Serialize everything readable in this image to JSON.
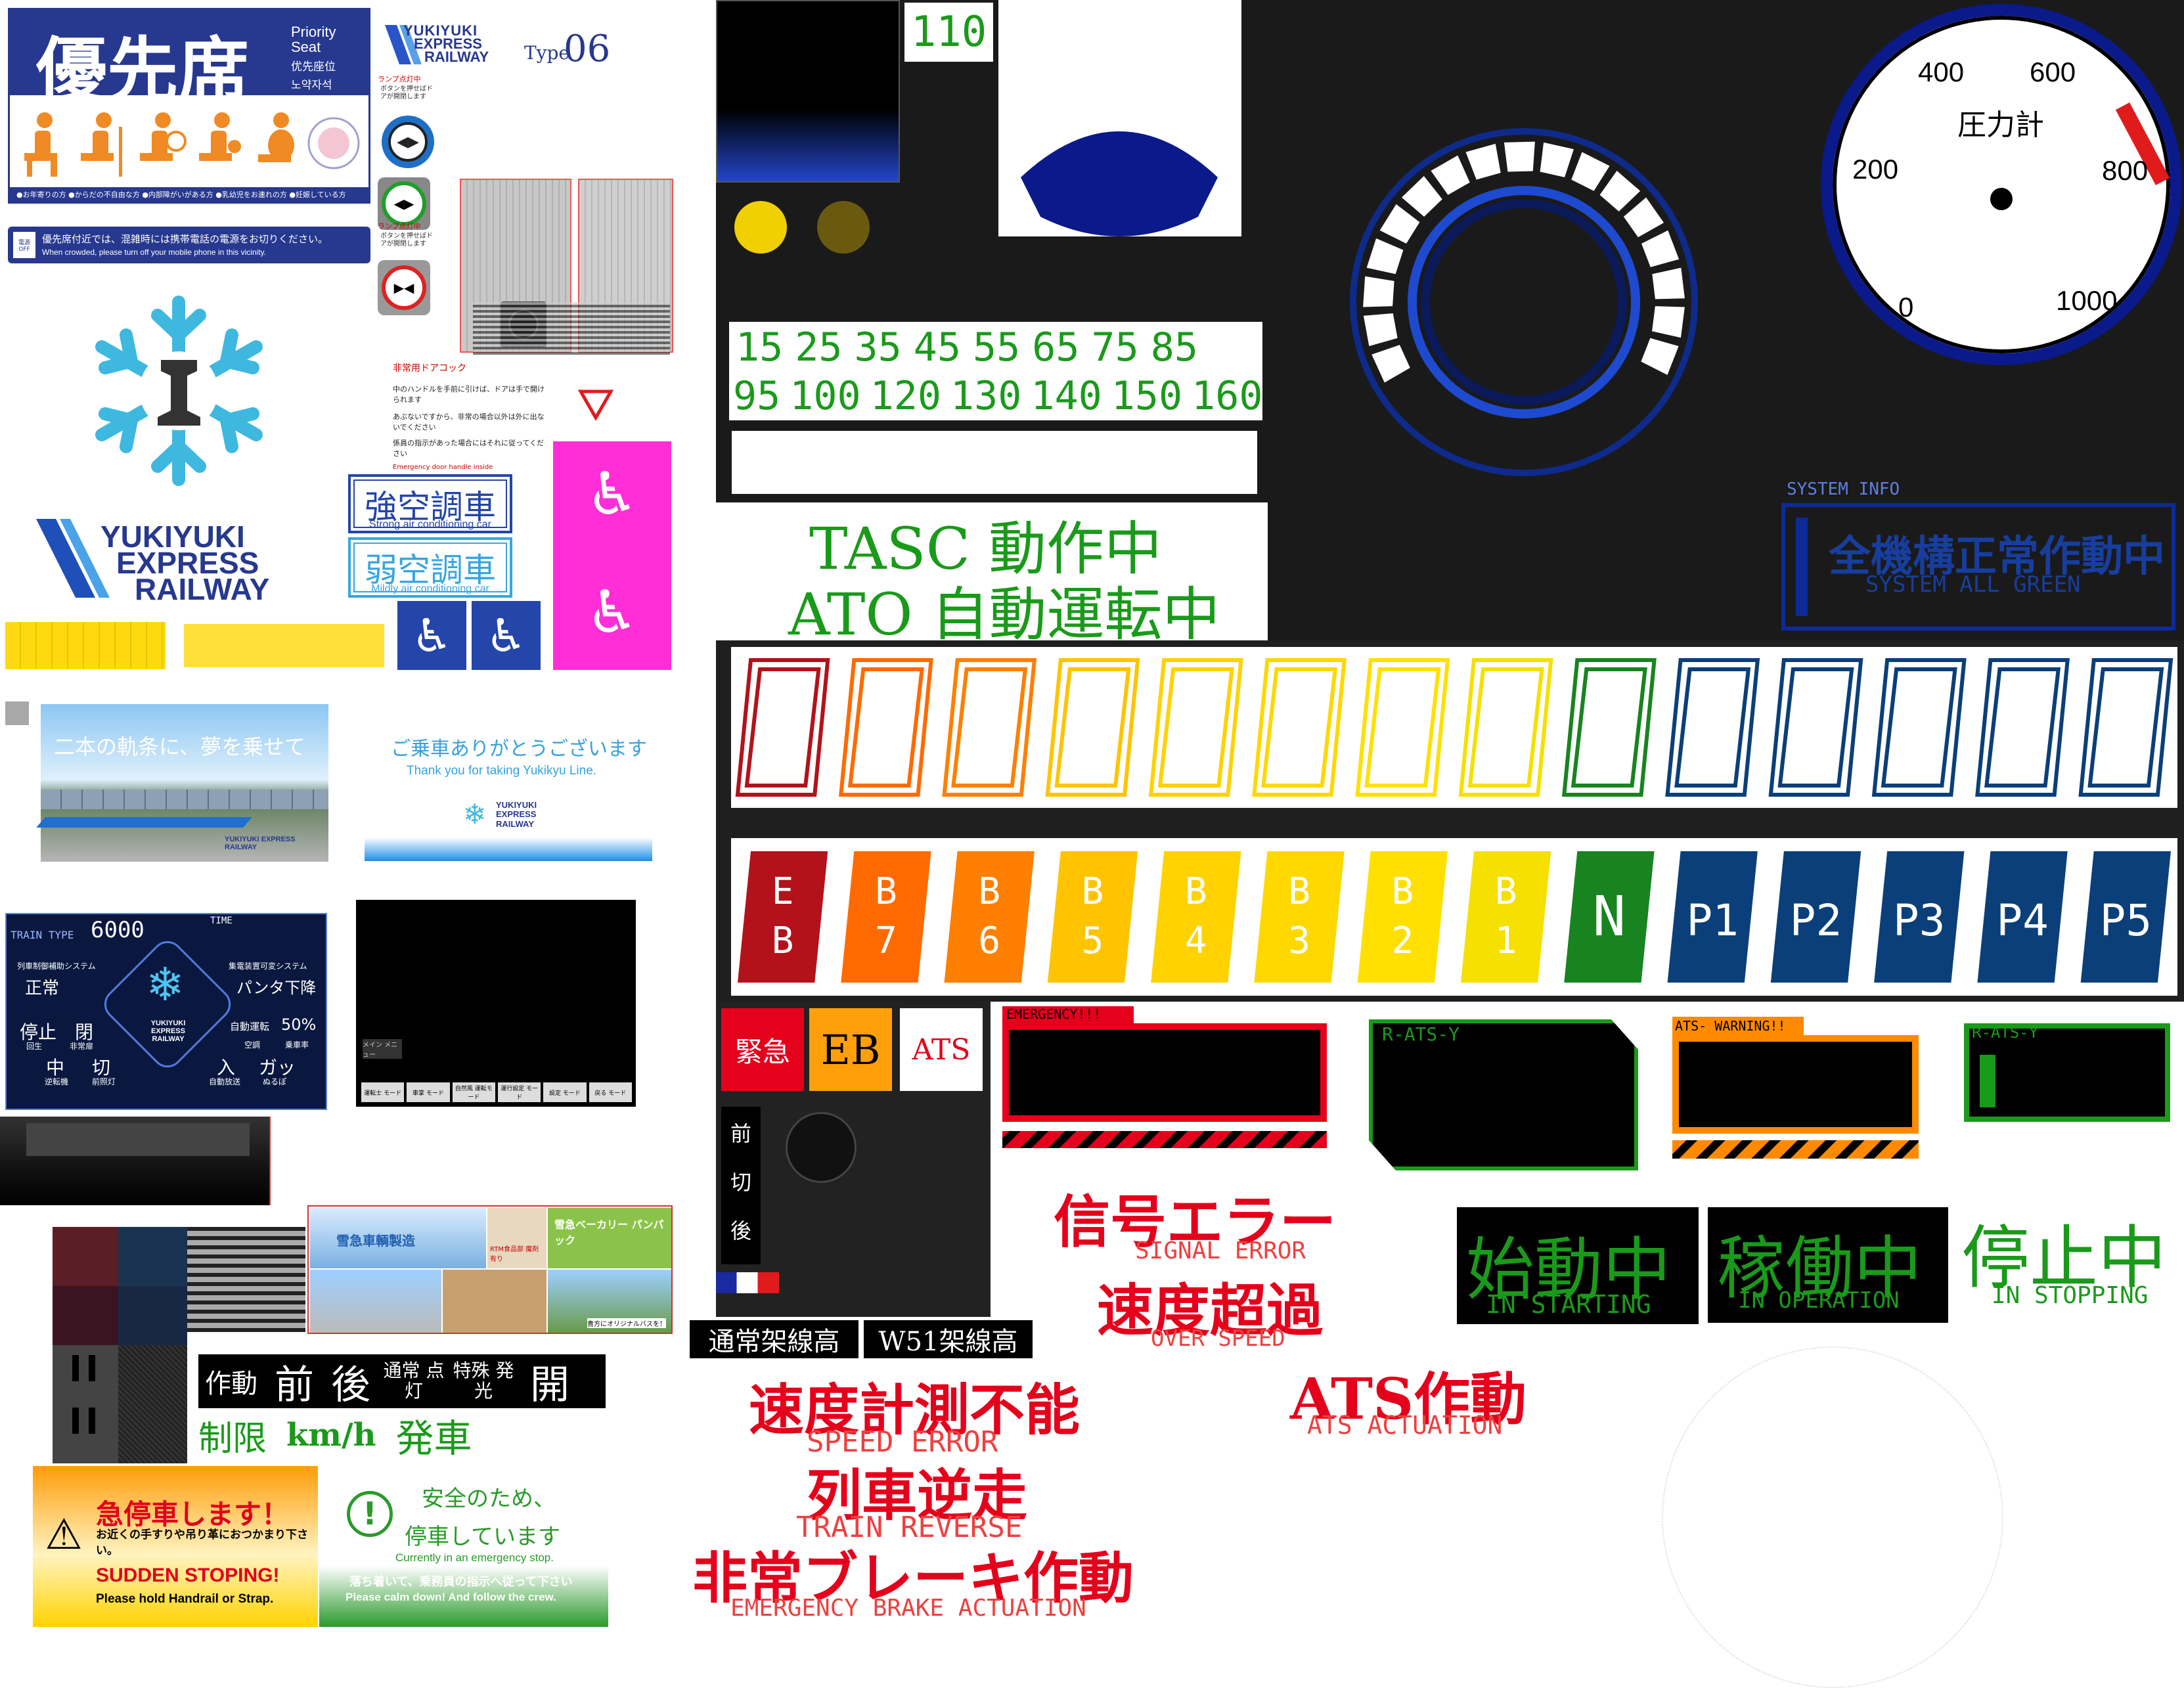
{
  "left": {
    "priority_seat": {
      "title": "優先席",
      "en": "Priority Seat",
      "zh": "优先座位",
      "ko": "노약자석",
      "notes": "●お年寄りの方 ●からだの不自由な方 ●内部障がいがある方 ●乳幼児をお連れの方 ●妊娠している方"
    },
    "phone_notice": {
      "jp": "優先席付近では、混雑時には携帯電話の電源をお切りください。",
      "en": "When crowded, please turn off your mobile phone in this vicinity.",
      "badge": "電源 OFF"
    },
    "type_logo": {
      "line1": "YUKIYUKI",
      "line2": "EXPRESS",
      "line3": "RAILWAY",
      "type": "Type",
      "num": "06"
    },
    "door_buttons": {
      "lamp_on": "ランプ点灯中",
      "push": "ボタンを押せばドアが開閉します"
    },
    "big_logo": {
      "line1": "YUKIYUKI",
      "line2": "EXPRESS",
      "line3": "RAILWAY"
    },
    "door_cock": {
      "title": "非常用ドアコック",
      "body1": "中のハンドルを手前に引けば、ドアは手で開けられます",
      "body2": "あぶないですから、非常の場合以外は外に出ないでください",
      "body3": "係員の指示があった場合にはそれに従ってください",
      "en": "Emergency door handle inside"
    },
    "ac_strong": {
      "jp": "強空調車",
      "en": "Strong air conditioning car"
    },
    "ac_weak": {
      "jp": "弱空調車",
      "en": "Mildly air conditioning car"
    },
    "banner": {
      "text": "二本の軌条に、夢を乗せて",
      "logo": "YUKIYUKI EXPRESS RAILWAY"
    },
    "thanks": {
      "jp": "ご乗車ありがとうございます",
      "en": "Thank you for taking Yukikyu Line.",
      "logo": "YUKIYUKI EXPRESS RAILWAY"
    },
    "train_panel": {
      "type_label": "TRAIN TYPE",
      "type_num": "6000",
      "time_label": "TIME",
      "sys1": "列車制御補助システム",
      "sys1_val": "正常",
      "sys2": "集電装置可変システム",
      "sys2_val": "パンタ下降",
      "stop": "停止",
      "stop_sub": "回生",
      "close": "閉",
      "close_sub": "非常扉",
      "auto": "自動運転",
      "auto_sub": "空調",
      "pct": "50%",
      "pct_sub": "乗車率",
      "mid": "中",
      "mid_sub": "逆転機",
      "cut": "切",
      "cut_sub": "前照灯",
      "in": "入",
      "in_sub": "自動放送",
      "gatsu": "ガッ",
      "gatsu_sub": "ぬるぽ",
      "logo": "YUKIYUKI EXPRESS RAILWAY"
    },
    "menu_panel": {
      "menu": "メイン メニュー",
      "buttons": [
        "運転士 モード",
        "車掌 モード",
        "自然風 運転モード",
        "運行設定 モード",
        "設定 モード",
        "戻る モード"
      ]
    },
    "ads": {
      "maker": "雪急車輌製造",
      "food": "RTM食品部 魔剤有り",
      "bread": "雪急ベーカリー パンパック",
      "bus": "貴方にオリジナルバスを！"
    },
    "mode_row1": [
      "作動",
      "前",
      "後",
      "通常 点灯",
      "特殊 発光",
      "開"
    ],
    "mode_row2": [
      "制限",
      "km/h",
      "発車"
    ],
    "emg_stop": {
      "jp": "急停車します！",
      "sub": "お近くの手すりや吊り革におつかまり下さい。",
      "en": "SUDDEN STOPING!",
      "en_sub": "Please hold Handrail or Strap."
    },
    "safety": {
      "jp1": "安全のため、",
      "jp2": "停車しています",
      "en": "Currently in an emergency stop.",
      "jp3": "落ち着いて、乗務員の指示へ従って下さい",
      "en2": "Please calm down! And follow the crew."
    }
  },
  "mid": {
    "speed_limit": "110",
    "speed_row1": [
      "15",
      "25",
      "35",
      "45",
      "55",
      "65",
      "75",
      "85"
    ],
    "speed_row2": [
      "95",
      "100",
      "120",
      "130",
      "140",
      "150",
      "160"
    ],
    "tasc": "TASC 動作中",
    "ato": "ATO 自動運転中",
    "notches": [
      {
        "t1": "E",
        "t2": "B",
        "color": "#b3121b"
      },
      {
        "t1": "B",
        "t2": "7",
        "color": "#ff6a00"
      },
      {
        "t1": "B",
        "t2": "6",
        "color": "#ff7f00"
      },
      {
        "t1": "B",
        "t2": "5",
        "color": "#ffc400"
      },
      {
        "t1": "B",
        "t2": "4",
        "color": "#ffd200"
      },
      {
        "t1": "B",
        "t2": "3",
        "color": "#ffd800"
      },
      {
        "t1": "B",
        "t2": "2",
        "color": "#ffe000"
      },
      {
        "t1": "B",
        "t2": "1",
        "color": "#f5e000"
      },
      {
        "t1": "N",
        "t2": "",
        "color": "#17841f"
      },
      {
        "t1": "P1",
        "t2": "",
        "color": "#0b3f79"
      },
      {
        "t1": "P2",
        "t2": "",
        "color": "#0b3f79"
      },
      {
        "t1": "P3",
        "t2": "",
        "color": "#0b3f79"
      },
      {
        "t1": "P4",
        "t2": "",
        "color": "#0b3f79"
      },
      {
        "t1": "P5",
        "t2": "",
        "color": "#0b3f79"
      }
    ],
    "btn_emg": "緊急",
    "btn_eb": "EB",
    "btn_ats": "ATS",
    "reverser": [
      "前",
      "切",
      "後"
    ],
    "catenary_normal": "通常架線高",
    "catenary_w51": "W51架線高",
    "speed_error": {
      "jp": "速度計測不能",
      "en": "SPEED ERROR"
    },
    "reverse": {
      "jp": "列車逆走",
      "en": "TRAIN REVERSE"
    },
    "emg_brake": {
      "jp": "非常ブレーキ作動",
      "en": "EMERGENCY BRAKE ACTUATION"
    }
  },
  "right": {
    "gauge": {
      "title": "圧力計",
      "ticks": [
        "0",
        "200",
        "400",
        "600",
        "800",
        "1000"
      ]
    },
    "system_info": {
      "label": "SYSTEM INFO",
      "jp": "全機構正常作動中",
      "en": "SYSTEM ALL GREEN"
    },
    "warn_emergency": "EMERGENCY!!!",
    "warn_ratsy": "R-ATS-Y",
    "warn_ats": "ATS- WARNING!!",
    "warn_ratsy2": "R-ATS-Y",
    "signal_error": {
      "jp": "信号エラー",
      "en": "SIGNAL ERROR"
    },
    "over_speed": {
      "jp": "速度超過",
      "en": "OVER SPEED"
    },
    "ats_act": {
      "jp": "ATS作動",
      "en": "ATS ACTUATION"
    },
    "starting": {
      "jp": "始動中",
      "en": "IN STARTING"
    },
    "operation": {
      "jp": "稼働中",
      "en": "IN OPERATION"
    },
    "stopping": {
      "jp": "停止中",
      "en": "IN STOPPING"
    }
  }
}
